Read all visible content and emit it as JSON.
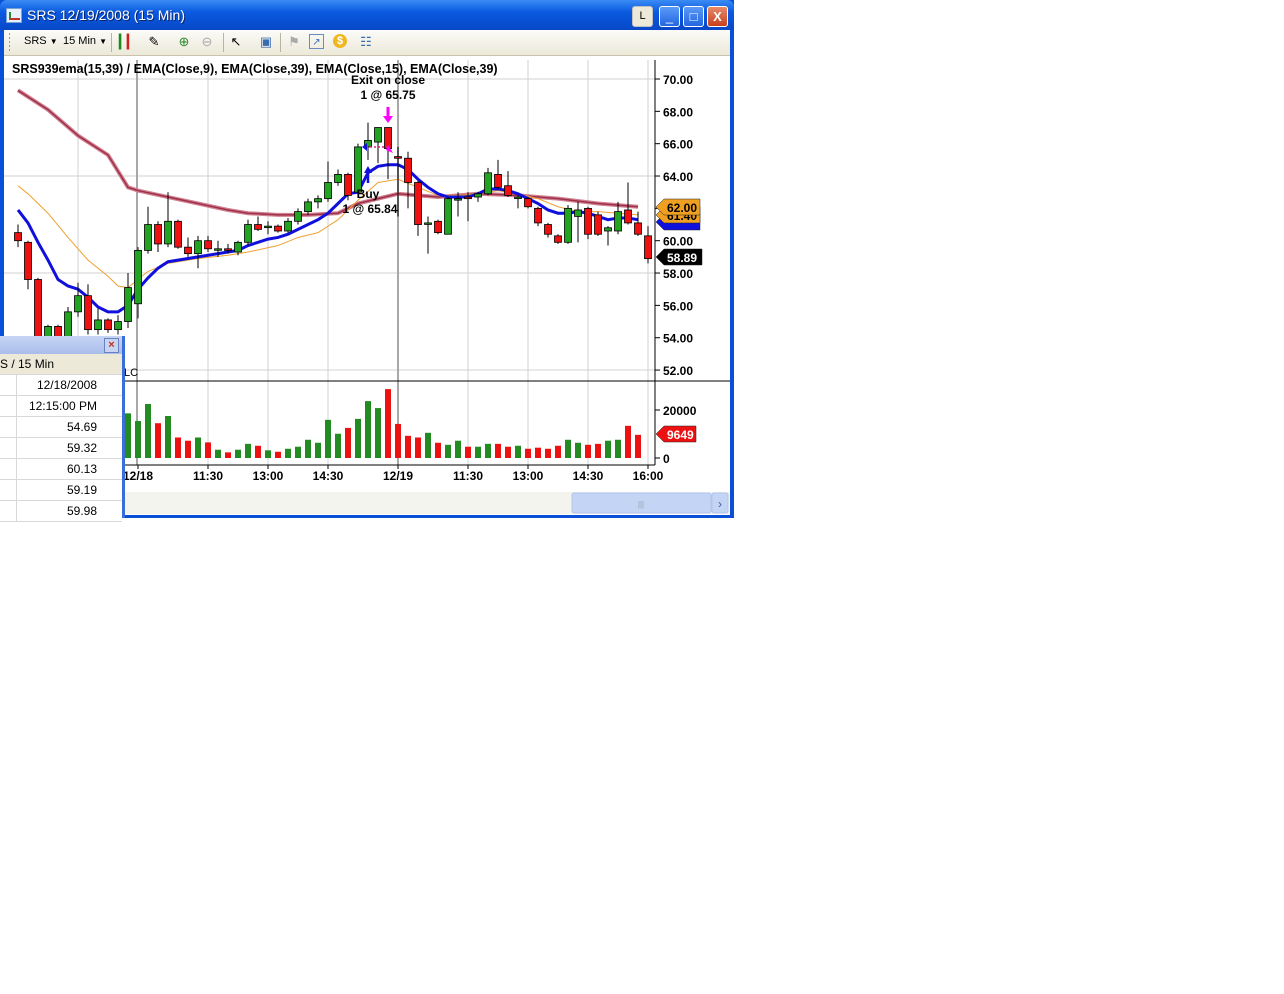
{
  "window": {
    "title": "SRS  12/19/2008 (15 Min)",
    "l_button": "L",
    "minimize": "_",
    "maximize": "□",
    "close": "X"
  },
  "toolbar": {
    "instrument": "SRS",
    "interval": "15 Min",
    "icons": [
      "candlestick-style-icon",
      "drawing-pencil-icon",
      "zoom-in-icon",
      "zoom-out-icon",
      "pointer-icon",
      "data-box-icon",
      "strategy-icon",
      "indicators-icon",
      "orders-icon",
      "properties-icon"
    ]
  },
  "chart": {
    "legend": "SRS939ema(15,39)  /  EMA(Close,9),  EMA(Close,39),  EMA(Close,15),  EMA(Close,39)",
    "hidden_label": "LC",
    "exit_label": "Exit on close",
    "exit_fill": "1 @ 65.75",
    "buy_label": "Buy",
    "buy_fill": "1 @ 65.84",
    "price_ticks": [
      "70.00",
      "68.00",
      "66.00",
      "64.00",
      "62.00",
      "60.00",
      "58.00",
      "56.00",
      "54.00",
      "52.00"
    ],
    "price_tag_ema39": "62.00",
    "price_tag_ema15": "61.40",
    "price_tag_last": "58.89",
    "volume_ticks": [
      "20000",
      "0"
    ],
    "volume_tag": "9649",
    "time_labels": [
      "12/18",
      "11:30",
      "13:00",
      "14:30",
      "12/19",
      "11:30",
      "13:00",
      "14:30",
      "16:00"
    ],
    "colors": {
      "up": "#22a322",
      "down": "#ee1111",
      "vol_up": "#228b22",
      "ema9": "#1010dd",
      "ema15": "#f0a030",
      "ema39": "#a0304a",
      "exit": "#ff00ff"
    }
  },
  "chart_data": {
    "type": "candlestick",
    "ylim": [
      51.5,
      71
    ],
    "candles_ohlc": [
      [
        60.5,
        61.0,
        59.6,
        60.0
      ],
      [
        59.9,
        60.0,
        57.0,
        57.6
      ],
      [
        57.6,
        57.7,
        53.0,
        53.4
      ],
      [
        53.6,
        54.8,
        53.2,
        54.7
      ],
      [
        54.7,
        54.8,
        53.8,
        54.0
      ],
      [
        54.0,
        55.9,
        53.8,
        55.6
      ],
      [
        55.6,
        57.4,
        55.3,
        56.6
      ],
      [
        56.6,
        57.3,
        54.2,
        54.5
      ],
      [
        54.5,
        55.8,
        54.2,
        55.1
      ],
      [
        55.1,
        55.2,
        54.3,
        54.5
      ],
      [
        54.5,
        55.4,
        54.2,
        55.0
      ],
      [
        55.0,
        58.0,
        54.6,
        57.1
      ],
      [
        56.1,
        59.6,
        55.2,
        59.4
      ],
      [
        59.4,
        62.1,
        59.2,
        61.0
      ],
      [
        61.0,
        61.2,
        59.3,
        59.8
      ],
      [
        59.8,
        63.0,
        59.6,
        61.2
      ],
      [
        61.2,
        61.3,
        59.5,
        59.6
      ],
      [
        59.6,
        60.2,
        59.0,
        59.2
      ],
      [
        59.2,
        60.3,
        58.3,
        60.0
      ],
      [
        60.0,
        60.3,
        59.3,
        59.5
      ],
      [
        59.5,
        60.0,
        59.0,
        59.5
      ],
      [
        59.5,
        59.8,
        59.2,
        59.4
      ],
      [
        59.3,
        60.0,
        59.1,
        59.9
      ],
      [
        59.9,
        61.3,
        59.7,
        61.0
      ],
      [
        61.0,
        61.5,
        60.6,
        60.7
      ],
      [
        60.9,
        61.2,
        60.4,
        60.9
      ],
      [
        60.9,
        61.0,
        60.5,
        60.6
      ],
      [
        60.6,
        61.4,
        60.5,
        61.2
      ],
      [
        61.2,
        62.0,
        61.0,
        61.8
      ],
      [
        61.8,
        62.6,
        61.6,
        62.4
      ],
      [
        62.4,
        62.8,
        62.0,
        62.6
      ],
      [
        62.6,
        64.9,
        62.4,
        63.6
      ],
      [
        63.6,
        64.4,
        63.4,
        64.1
      ],
      [
        64.1,
        64.2,
        62.5,
        62.8
      ],
      [
        63.0,
        66.0,
        62.8,
        65.8
      ],
      [
        65.8,
        67.3,
        65.0,
        66.2
      ],
      [
        66.1,
        67.0,
        64.8,
        67.0
      ],
      [
        67.0,
        67.0,
        63.8,
        65.7
      ],
      [
        65.2,
        65.8,
        61.5,
        65.1
      ],
      [
        65.1,
        65.5,
        62.0,
        63.6
      ],
      [
        63.6,
        63.7,
        60.3,
        61.0
      ],
      [
        61.1,
        61.5,
        59.2,
        61.1
      ],
      [
        61.2,
        61.3,
        60.4,
        60.5
      ],
      [
        60.4,
        62.7,
        60.4,
        62.6
      ],
      [
        62.6,
        63.0,
        61.5,
        62.6
      ],
      [
        62.7,
        63.0,
        61.2,
        62.6
      ],
      [
        62.7,
        63.0,
        62.4,
        62.9
      ],
      [
        62.9,
        64.5,
        62.8,
        64.2
      ],
      [
        64.1,
        65.0,
        63.2,
        63.3
      ],
      [
        63.4,
        64.3,
        62.7,
        62.8
      ],
      [
        62.7,
        62.8,
        62.0,
        62.7
      ],
      [
        62.6,
        62.7,
        62.0,
        62.1
      ],
      [
        62.0,
        62.1,
        60.9,
        61.1
      ],
      [
        61.0,
        61.1,
        60.2,
        60.4
      ],
      [
        60.3,
        60.4,
        59.8,
        59.9
      ],
      [
        59.9,
        62.2,
        59.8,
        62.0
      ],
      [
        61.5,
        62.4,
        59.9,
        61.9
      ],
      [
        62.0,
        62.1,
        60.1,
        60.4
      ],
      [
        61.6,
        61.8,
        60.3,
        60.4
      ],
      [
        60.6,
        60.9,
        59.7,
        60.8
      ],
      [
        60.6,
        62.4,
        60.4,
        61.8
      ],
      [
        61.9,
        63.6,
        61.0,
        61.1
      ],
      [
        61.1,
        61.8,
        60.3,
        60.4
      ],
      [
        60.3,
        60.9,
        58.6,
        58.89
      ]
    ],
    "volume": [
      null,
      null,
      null,
      null,
      null,
      null,
      null,
      null,
      null,
      null,
      null,
      18600,
      15400,
      22500,
      14500,
      17500,
      8550,
      7200,
      8550,
      6500,
      3450,
      2350,
      3450,
      5900,
      5100,
      3200,
      2600,
      3850,
      4700,
      7600,
      6350,
      15900,
      10100,
      12550,
      16300,
      23700,
      20800,
      28700,
      14200,
      9250,
      8550,
      10500,
      6350,
      5500,
      7200,
      4700,
      4700,
      5900,
      5900,
      4700,
      5100,
      3850,
      4300,
      3850,
      5100,
      7600,
      6350,
      5500,
      5900,
      7200,
      7600,
      13400,
      9649,
      null
    ],
    "volume_ylim": [
      0,
      28000
    ],
    "ema9": [
      [
        0,
        61.9
      ],
      [
        1,
        61.1
      ],
      [
        2,
        59.9
      ],
      [
        3,
        58.8
      ],
      [
        4,
        57.6
      ],
      [
        5,
        57.2
      ],
      [
        6,
        57.0
      ],
      [
        7,
        56.5
      ],
      [
        8,
        55.9
      ],
      [
        9,
        55.6
      ],
      [
        10,
        55.6
      ],
      [
        11,
        56.0
      ],
      [
        12,
        57.0
      ],
      [
        13,
        57.7
      ],
      [
        14,
        58.3
      ],
      [
        15,
        58.7
      ],
      [
        16,
        58.8
      ],
      [
        17,
        58.9
      ],
      [
        18,
        59.0
      ],
      [
        19,
        59.1
      ],
      [
        20,
        59.2
      ],
      [
        21,
        59.3
      ],
      [
        22,
        59.4
      ],
      [
        23,
        59.7
      ],
      [
        24,
        59.9
      ],
      [
        25,
        60.1
      ],
      [
        26,
        60.2
      ],
      [
        27,
        60.4
      ],
      [
        28,
        60.7
      ],
      [
        29,
        61.0
      ],
      [
        30,
        61.3
      ],
      [
        31,
        61.7
      ],
      [
        32,
        62.3
      ],
      [
        33,
        62.9
      ],
      [
        34,
        63.0
      ],
      [
        35,
        64.2
      ],
      [
        36,
        64.6
      ],
      [
        37,
        64.7
      ],
      [
        38,
        64.7
      ],
      [
        39,
        64.4
      ],
      [
        40,
        63.8
      ],
      [
        41,
        63.3
      ],
      [
        42,
        62.9
      ],
      [
        43,
        62.7
      ],
      [
        44,
        62.7
      ],
      [
        45,
        62.7
      ],
      [
        46,
        62.9
      ],
      [
        47,
        63.2
      ],
      [
        48,
        63.2
      ],
      [
        49,
        63.1
      ],
      [
        50,
        62.9
      ],
      [
        51,
        62.6
      ],
      [
        52,
        62.3
      ],
      [
        53,
        61.9
      ],
      [
        54,
        61.7
      ],
      [
        55,
        61.7
      ],
      [
        56,
        61.8
      ],
      [
        57,
        61.7
      ],
      [
        58,
        61.5
      ],
      [
        59,
        61.3
      ],
      [
        60,
        61.4
      ],
      [
        61,
        61.4
      ],
      [
        62,
        61.3
      ]
    ],
    "ema15": [
      [
        0,
        63.4
      ],
      [
        1,
        62.9
      ],
      [
        3,
        61.7
      ],
      [
        5,
        60.2
      ],
      [
        7,
        58.8
      ],
      [
        9,
        57.8
      ],
      [
        10,
        57.2
      ],
      [
        11,
        57.1
      ],
      [
        12,
        57.6
      ],
      [
        13,
        58.1
      ],
      [
        15,
        58.6
      ],
      [
        18,
        58.9
      ],
      [
        21,
        59.1
      ],
      [
        23,
        59.3
      ],
      [
        26,
        59.7
      ],
      [
        28,
        60.2
      ],
      [
        30,
        60.5
      ],
      [
        32,
        61.3
      ],
      [
        34,
        62.5
      ],
      [
        36,
        63.6
      ],
      [
        38,
        63.8
      ],
      [
        40,
        63.3
      ],
      [
        42,
        62.8
      ],
      [
        44,
        62.8
      ],
      [
        46,
        62.9
      ],
      [
        48,
        63.1
      ],
      [
        50,
        62.9
      ],
      [
        52,
        62.6
      ],
      [
        54,
        62.1
      ],
      [
        56,
        61.8
      ],
      [
        58,
        61.8
      ],
      [
        60,
        61.7
      ],
      [
        62,
        61.6
      ]
    ],
    "ema39": [
      [
        0,
        69.3
      ],
      [
        3,
        68.1
      ],
      [
        6,
        66.5
      ],
      [
        9,
        65.3
      ],
      [
        11,
        63.3
      ],
      [
        12,
        63.1
      ],
      [
        15,
        62.7
      ],
      [
        18,
        62.3
      ],
      [
        21,
        61.9
      ],
      [
        23,
        61.7
      ],
      [
        26,
        61.6
      ],
      [
        29,
        61.6
      ],
      [
        32,
        61.7
      ],
      [
        34,
        62.3
      ],
      [
        38,
        62.9
      ],
      [
        42,
        62.7
      ],
      [
        46,
        62.9
      ],
      [
        50,
        62.8
      ],
      [
        54,
        62.6
      ],
      [
        58,
        62.3
      ],
      [
        62,
        62.1
      ]
    ]
  },
  "data_box": {
    "header": "S / 15 Min",
    "rows": [
      "12/18/2008",
      "12:15:00 PM",
      "54.69",
      "59.32",
      "60.13",
      "59.19",
      "59.98"
    ],
    "close": "×"
  }
}
